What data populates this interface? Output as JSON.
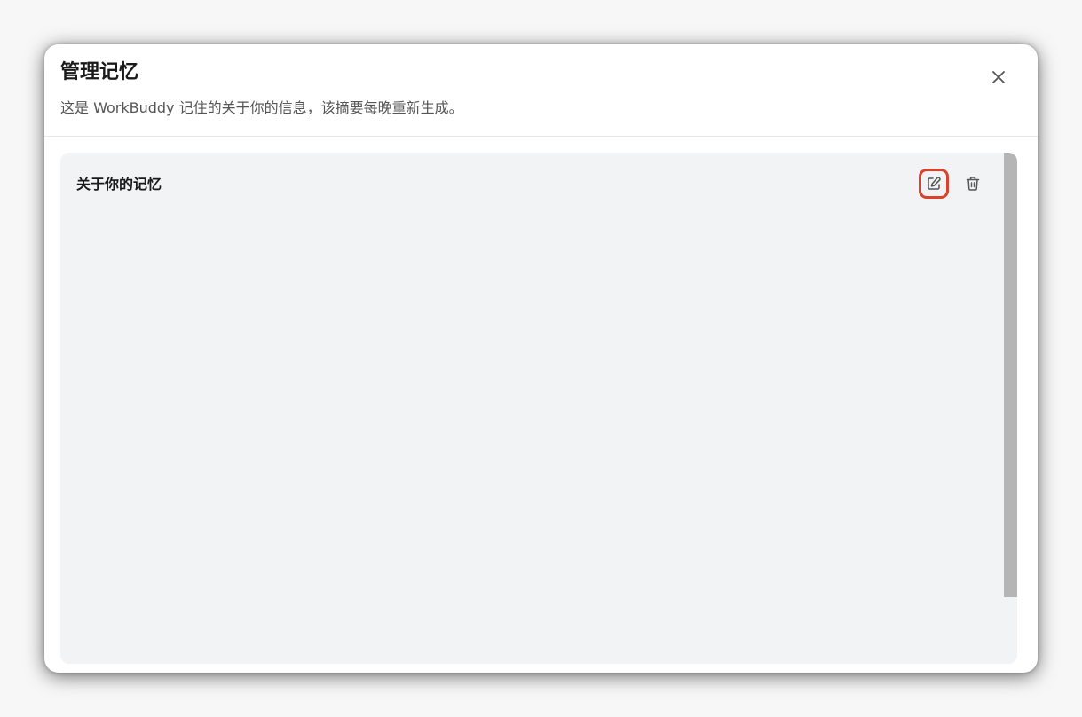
{
  "dialog": {
    "title": "管理记忆",
    "subtitle": "这是 WorkBuddy 记住的关于你的信息，该摘要每晚重新生成。"
  },
  "card": {
    "title": "关于你的记忆",
    "content": ""
  },
  "icons": {
    "close": "close-icon",
    "edit": "edit-icon",
    "delete": "trash-icon"
  },
  "colors": {
    "highlight": "#d9432b",
    "card_background": "#f2f3f5",
    "scrollbar": "#b5b5b5"
  }
}
